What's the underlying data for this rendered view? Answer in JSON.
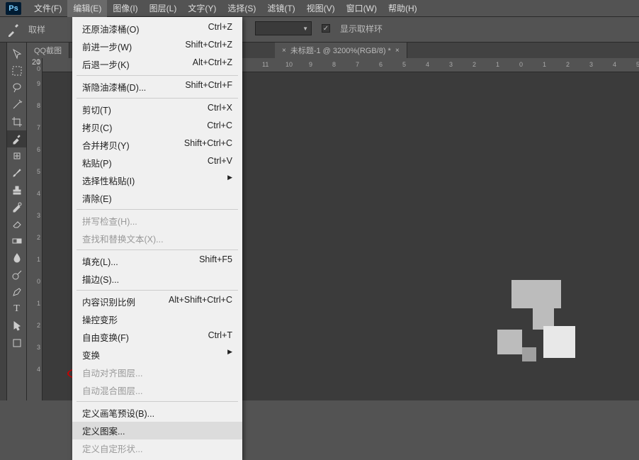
{
  "menubar": {
    "logo": "Ps",
    "items": [
      "文件(F)",
      "编辑(E)",
      "图像(I)",
      "图层(L)",
      "文字(Y)",
      "选择(S)",
      "滤镜(T)",
      "视图(V)",
      "窗口(W)",
      "帮助(H)"
    ],
    "active_index": 1
  },
  "options": {
    "sample_label": "取样",
    "sample_ring": "显示取样环"
  },
  "tabs": {
    "tab1": "QQ截图",
    "tab2": "未标题-1 @ 3200%(RGB/8) *"
  },
  "vruler_ticks": [
    "1\n0",
    "9",
    "8",
    "7",
    "6",
    "5",
    "4",
    "3",
    "2",
    "1",
    "0",
    "1",
    "2",
    "3",
    "4"
  ],
  "hruler_ticks": [
    "11",
    "10",
    "9",
    "8",
    "7",
    "6",
    "5",
    "4",
    "3",
    "2",
    "1",
    "0",
    "1",
    "2",
    "3",
    "4",
    "5"
  ],
  "ruler_20": "20",
  "dropdown": [
    {
      "label": "还原油漆桶(O)",
      "sc": "Ctrl+Z"
    },
    {
      "label": "前进一步(W)",
      "sc": "Shift+Ctrl+Z"
    },
    {
      "label": "后退一步(K)",
      "sc": "Alt+Ctrl+Z"
    },
    {
      "sep": true
    },
    {
      "label": "渐隐油漆桶(D)...",
      "sc": "Shift+Ctrl+F"
    },
    {
      "sep": true
    },
    {
      "label": "剪切(T)",
      "sc": "Ctrl+X"
    },
    {
      "label": "拷贝(C)",
      "sc": "Ctrl+C"
    },
    {
      "label": "合并拷贝(Y)",
      "sc": "Shift+Ctrl+C"
    },
    {
      "label": "粘贴(P)",
      "sc": "Ctrl+V"
    },
    {
      "label": "选择性粘贴(I)",
      "arrow": true
    },
    {
      "label": "清除(E)"
    },
    {
      "sep": true
    },
    {
      "label": "拼写检查(H)...",
      "dis": true
    },
    {
      "label": "查找和替换文本(X)...",
      "dis": true
    },
    {
      "sep": true
    },
    {
      "label": "填充(L)...",
      "sc": "Shift+F5"
    },
    {
      "label": "描边(S)..."
    },
    {
      "sep": true
    },
    {
      "label": "内容识别比例",
      "sc": "Alt+Shift+Ctrl+C"
    },
    {
      "label": "操控变形"
    },
    {
      "label": "自由变换(F)",
      "sc": "Ctrl+T"
    },
    {
      "label": "变换",
      "arrow": true
    },
    {
      "label": "自动对齐图层...",
      "dis": true
    },
    {
      "label": "自动混合图层...",
      "dis": true
    },
    {
      "sep": true
    },
    {
      "label": "定义画笔预设(B)..."
    },
    {
      "label": "定义图案...",
      "hi": true
    },
    {
      "label": "定义自定形状...",
      "dis": true
    }
  ]
}
